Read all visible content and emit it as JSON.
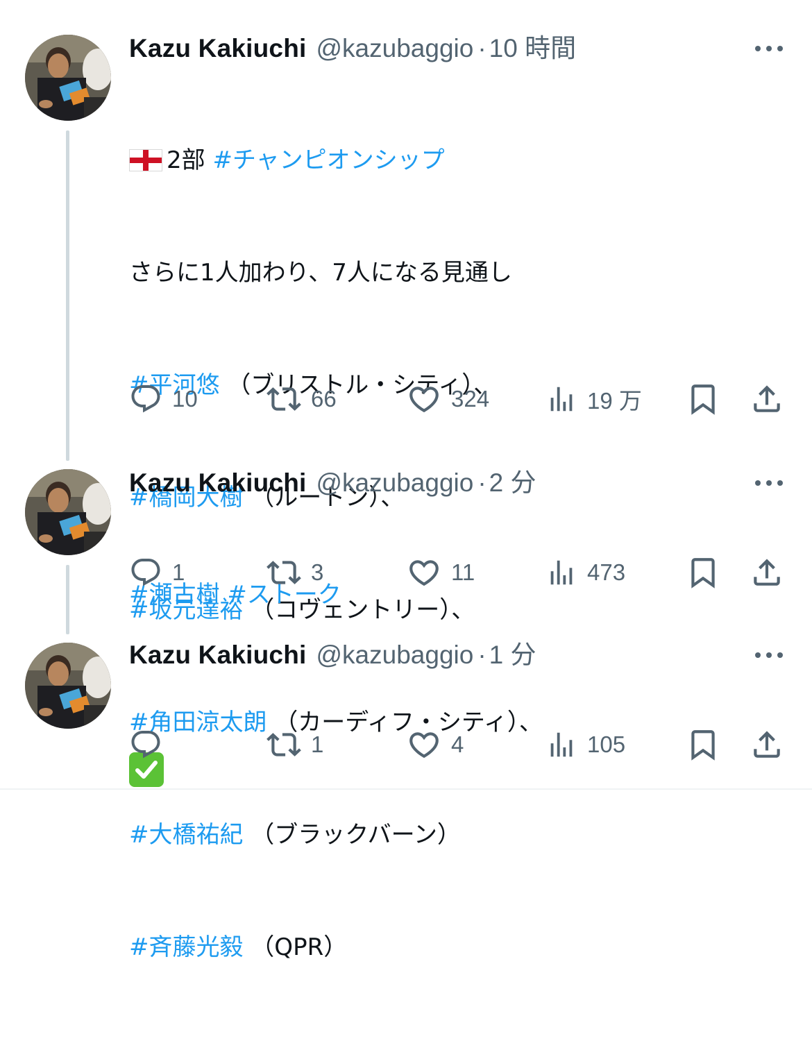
{
  "tweets": [
    {
      "author": {
        "name": "Kazu Kakiuchi",
        "handle": "@kazubaggio"
      },
      "time": "10 時間",
      "lines": [
        [
          {
            "type": "emoji",
            "icon": "england-flag-icon"
          },
          {
            "type": "text",
            "text": "2部 "
          },
          {
            "type": "tag",
            "text": "#チャンピオンシップ"
          }
        ],
        [
          {
            "type": "text",
            "text": "さらに1人加わり、7人になる見通し"
          }
        ],
        [
          {
            "type": "tag",
            "text": "#平河悠"
          },
          {
            "type": "text",
            "text": " （ブリストル・シティ）、"
          }
        ],
        [
          {
            "type": "tag",
            "text": "#橋岡大樹"
          },
          {
            "type": "text",
            "text": " （ルートン）、"
          }
        ],
        [
          {
            "type": "tag",
            "text": "#坂元達裕"
          },
          {
            "type": "text",
            "text": " （コヴェントリー）、"
          }
        ],
        [
          {
            "type": "tag",
            "text": "#角田涼太朗"
          },
          {
            "type": "text",
            "text": " （カーディフ・シティ）、"
          }
        ],
        [
          {
            "type": "tag",
            "text": "#大橋祐紀"
          },
          {
            "type": "text",
            "text": " （ブラックバーン）"
          }
        ],
        [
          {
            "type": "tag",
            "text": "#斉藤光毅"
          },
          {
            "type": "text",
            "text": " （QPR）"
          }
        ]
      ],
      "stats": {
        "replies": "10",
        "retweets": "66",
        "likes": "324",
        "views": "19 万"
      }
    },
    {
      "author": {
        "name": "Kazu Kakiuchi",
        "handle": "@kazubaggio"
      },
      "time": "2 分",
      "lines": [
        [
          {
            "type": "tag",
            "text": "#瀬古樹"
          },
          {
            "type": "text",
            "text": " "
          },
          {
            "type": "tag",
            "text": "#ストーク"
          }
        ]
      ],
      "stats": {
        "replies": "1",
        "retweets": "3",
        "likes": "11",
        "views": "473"
      }
    },
    {
      "author": {
        "name": "Kazu Kakiuchi",
        "handle": "@kazubaggio"
      },
      "time": "1 分",
      "lines": [
        [
          {
            "type": "emoji",
            "icon": "check-mark-button-icon"
          }
        ]
      ],
      "stats": {
        "replies": "",
        "retweets": "1",
        "likes": "4",
        "views": "105"
      }
    }
  ],
  "separator": "·",
  "colors": {
    "text": "#0f1419",
    "secondary": "#536471",
    "link": "#1d9bf0",
    "thread_line": "#cfd9de"
  }
}
